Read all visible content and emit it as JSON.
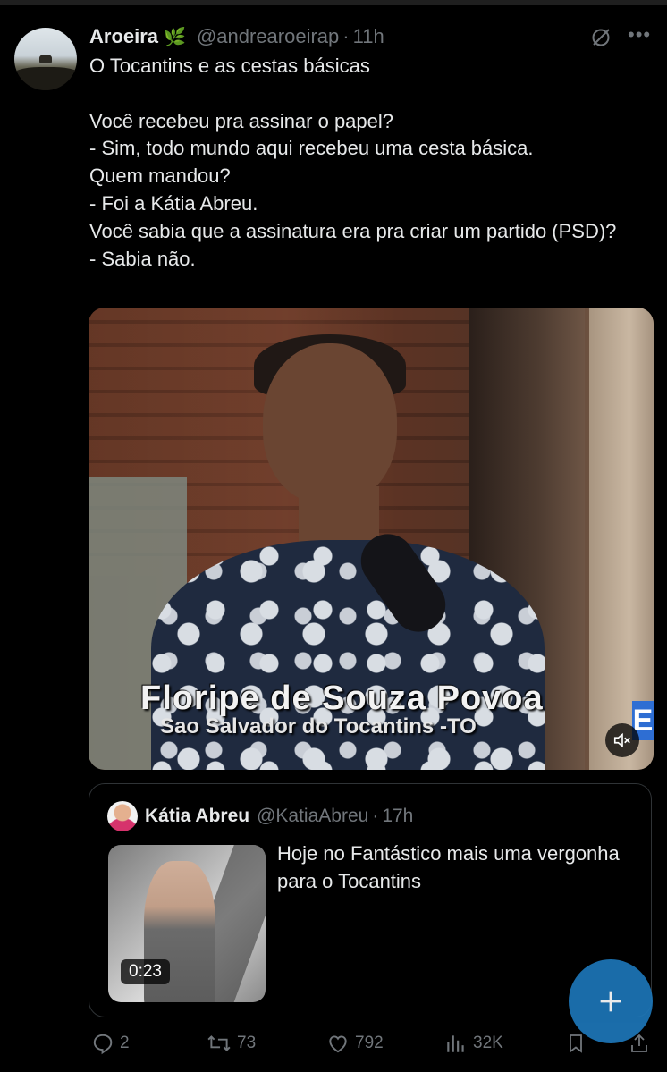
{
  "author": {
    "name": "Aroeira",
    "badge_emoji": "🌿",
    "handle": "@andrearoeirap",
    "time": "11h"
  },
  "tweet": {
    "text": "O Tocantins e as cestas básicas\n\nVocê recebeu pra assinar o papel?\n- Sim, todo mundo aqui recebeu uma cesta básica.\nQuem mandou?\n- Foi a Kátia Abreu.\nVocê sabia que a assinatura era pra criar um partido (PSD)?\n- Sabia não."
  },
  "media": {
    "caption_name": "Floripe de Souza Povoa",
    "caption_place": "Sao Salvador do Tocantins -TO",
    "logo_letter": "E",
    "muted": true
  },
  "quoted": {
    "name": "Kátia Abreu",
    "handle": "@KatiaAbreu",
    "time": "17h",
    "text": "Hoje no Fantástico mais uma vergonha para o Tocantins",
    "video_duration": "0:23"
  },
  "actions": {
    "replies": "2",
    "reposts": "73",
    "likes": "792",
    "views": "32K"
  },
  "colors": {
    "background": "#000000",
    "text": "#e7e9ea",
    "muted": "#71767b",
    "fab": "#1d76b8"
  }
}
